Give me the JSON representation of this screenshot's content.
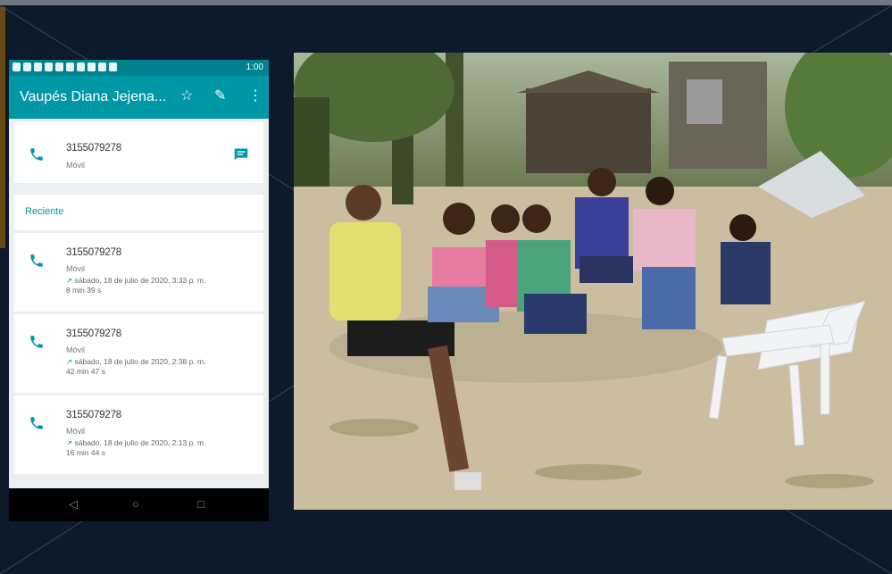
{
  "status_bar": {
    "time": "1:00"
  },
  "app_bar": {
    "title": "Vaupés Diana Jejena..."
  },
  "contact": {
    "number": "3155079278",
    "type": "Móvil"
  },
  "recent": {
    "label": "Reciente",
    "calls": [
      {
        "number": "3155079278",
        "type": "Móvil",
        "date": "sábado, 18 de julio de 2020, 3:33 p. m.",
        "duration": "8 min 39 s"
      },
      {
        "number": "3155079278",
        "type": "Móvil",
        "date": "sábado, 18 de julio de 2020, 2:38 p. m.",
        "duration": "42 min 47 s"
      },
      {
        "number": "3155079278",
        "type": "Móvil",
        "date": "sábado, 18 de julio de 2020, 2:13 p. m.",
        "duration": "16 min 44 s"
      }
    ]
  },
  "icons": {
    "star": "star-icon",
    "edit": "pencil-icon",
    "more": "more-vert-icon",
    "phone": "phone-icon",
    "message": "message-icon",
    "back": "back-icon",
    "home": "home-icon",
    "recents": "recents-icon"
  },
  "colors": {
    "accent": "#0097a7",
    "status": "#00838f",
    "background": "#0d1a2b"
  }
}
